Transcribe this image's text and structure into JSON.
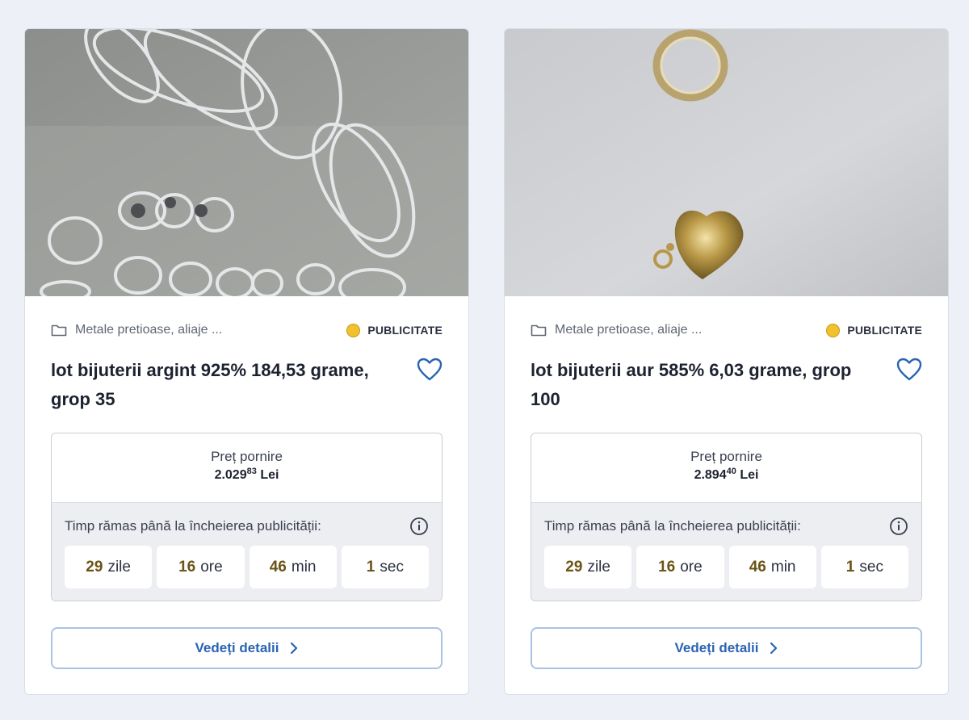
{
  "colors": {
    "page_bg": "#eef0f7",
    "accent_blue": "#2a63b3",
    "badge_dot": "#f2c12e",
    "timer_number": "#6a5416"
  },
  "cards": [
    {
      "category": "Metale pretioase, aliaje ...",
      "badge": "PUBLICITATE",
      "title": "lot bijuterii argint 925% 184,53 grame, grop 35",
      "price_label": "Preț pornire",
      "price_main": "2.029",
      "price_cents": "83",
      "currency": "Lei",
      "timer_label": "Timp rămas până la încheierea publicității:",
      "days": "29",
      "days_unit": "zile",
      "hours": "16",
      "hours_unit": "ore",
      "minutes": "46",
      "minutes_unit": "min",
      "seconds": "1",
      "seconds_unit": "sec",
      "details_label": "Vedeți detalii",
      "icons": [
        "folder-icon",
        "heart-icon",
        "info-icon",
        "chevron-right-icon"
      ]
    },
    {
      "category": "Metale pretioase, aliaje ...",
      "badge": "PUBLICITATE",
      "title": "lot bijuterii aur 585% 6,03 grame, grop 100",
      "price_label": "Preț pornire",
      "price_main": "2.894",
      "price_cents": "40",
      "currency": "Lei",
      "timer_label": "Timp rămas până la încheierea publicității:",
      "days": "29",
      "days_unit": "zile",
      "hours": "16",
      "hours_unit": "ore",
      "minutes": "46",
      "minutes_unit": "min",
      "seconds": "1",
      "seconds_unit": "sec",
      "details_label": "Vedeți detalii",
      "icons": [
        "folder-icon",
        "heart-icon",
        "info-icon",
        "chevron-right-icon"
      ]
    }
  ]
}
